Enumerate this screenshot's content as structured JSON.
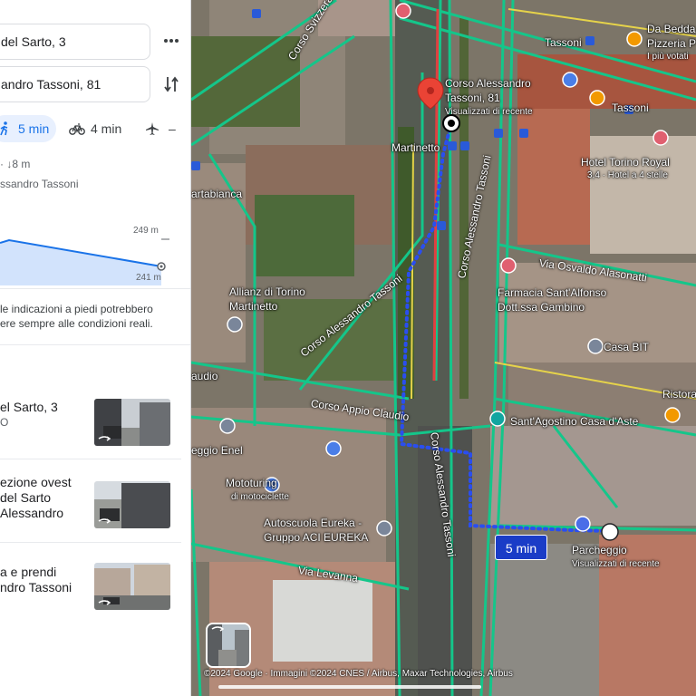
{
  "panel": {
    "origin": "del Sarto, 3",
    "destination": "andro Tassoni, 81",
    "modes": [
      {
        "id": "walk",
        "label": "5 min",
        "active": true
      },
      {
        "id": "bike",
        "label": "4 min",
        "active": false
      },
      {
        "id": "flight",
        "label": "–",
        "active": false
      }
    ],
    "summary_stats": "· ↓8 m",
    "summary_via": "ssandro Tassoni",
    "elevation": {
      "max_label": "249 m",
      "min_label": "241 m",
      "values": [
        249,
        248,
        247,
        245,
        243,
        241
      ]
    },
    "disclaimer_line1": "le indicazioni a piedi potrebbero",
    "disclaimer_line2": "ere sempre alle condizioni reali.",
    "steps": [
      {
        "line1": "el Sarto, 3",
        "line2": "O"
      },
      {
        "line1": "ezione ovest",
        "line2": "del Sarto",
        "line3": "Alessandro"
      },
      {
        "line1": "a e prendi",
        "line2": "ndro Tassoni"
      }
    ]
  },
  "map": {
    "labels": {
      "corso_svizzera": "Corso Svizzera",
      "dest_name_1": "Corso Alessandro",
      "dest_name_2": "Tassoni, 81",
      "dest_sub": "Visualizzati di recente",
      "martinetto": "Martinetto",
      "tassoni_top": "Tassoni",
      "tassoni_right": "Tassoni",
      "da_bedda_1": "Da Bedda",
      "da_bedda_2": "Pizzeria P",
      "da_bedda_3": "I più votati",
      "hotel_1": "Hotel Torino Royal",
      "hotel_2": "3,4 · Hotel a 4 stelle",
      "artabianca": "artabianca",
      "via_alasonatti": "Via Osvaldo Alasonatti",
      "farmacia_1": "Farmacia Sant'Alfonso",
      "farmacia_2": "Dott.ssa Gambino",
      "allianz_1": "Allianz di Torino",
      "allianz_2": "Martinetto",
      "casa_bit": "Casa BIT",
      "corso_tassoni_diag": "Corso Alessandro Tassoni",
      "corso_tassoni_vert": "Corso Alessandro Tassoni",
      "corso_tassoni_low": "Corso Alessandro Tassoni",
      "audio": "audio",
      "corso_appio": "Corso Appio Claudio",
      "ristora": "Ristora",
      "agostino": "Sant'Agostino Casa d'Aste",
      "enel": "eggio Enel",
      "mototuring_1": "Mototuring",
      "mototuring_2": "di motociclette",
      "eureka_1": "Autoscuola Eureka -",
      "eureka_2": "Gruppo ACI EUREKA",
      "parcheggio_1": "Parcheggio",
      "parcheggio_2": "Visualizzati di recente",
      "via_levanna": "Via Levanna"
    },
    "time_badge": "5 min",
    "attribution": "©2024 Google · Immagini ©2024 CNES / Airbus, Maxar Technologies, Airbus"
  },
  "colors": {
    "route": "#1a47e8",
    "accent": "#1a73e8",
    "road": "#10c080",
    "pin": "#ea4335"
  }
}
